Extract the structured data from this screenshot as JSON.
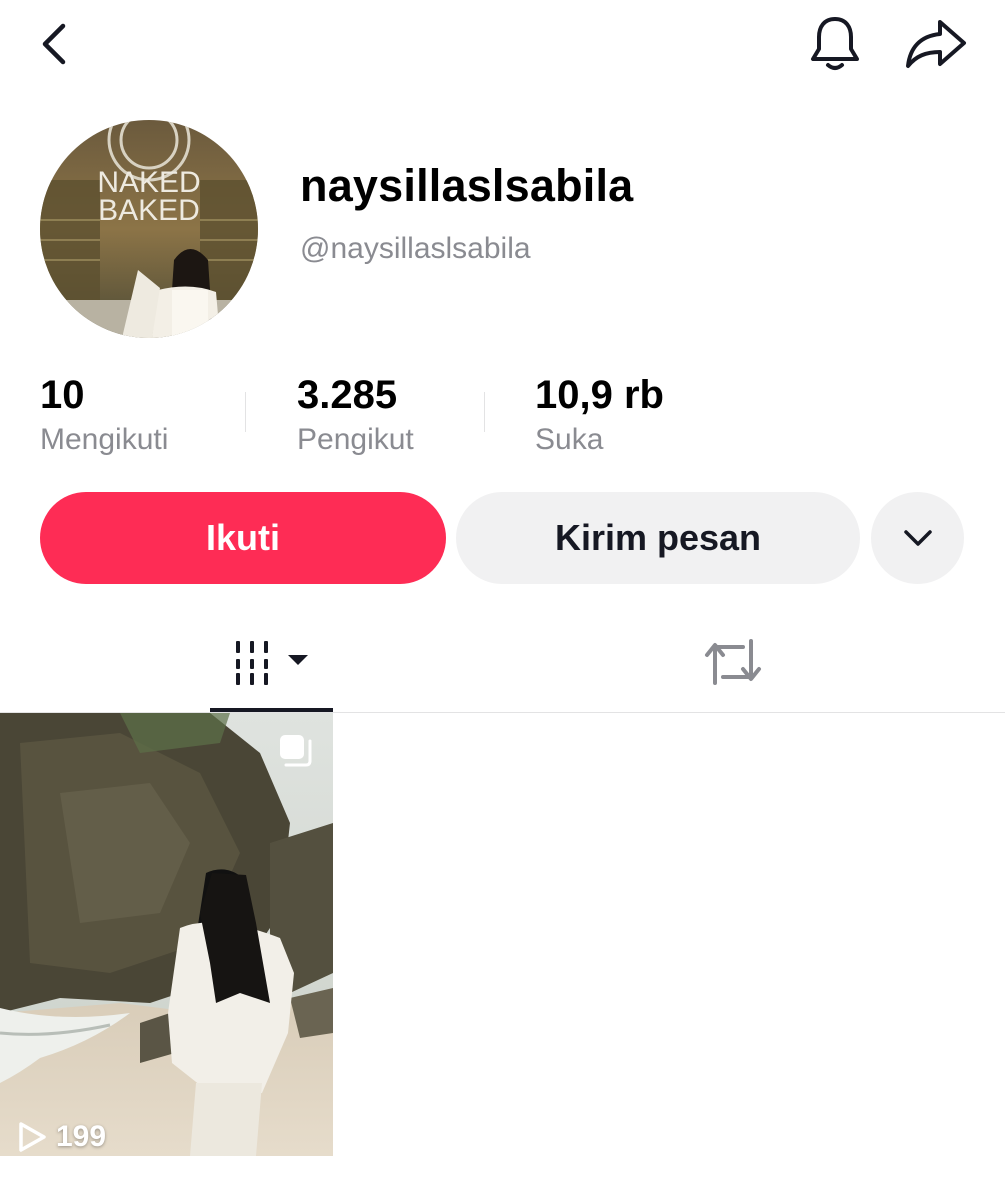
{
  "profile": {
    "username": "naysillaslsabila",
    "handle": "@naysillaslsabila",
    "avatar_sign_text": [
      "NAKED",
      "BAKED"
    ]
  },
  "stats": [
    {
      "value": "10",
      "label": "Mengikuti"
    },
    {
      "value": "3.285",
      "label": "Pengikut"
    },
    {
      "value": "10,9 rb",
      "label": "Suka"
    }
  ],
  "actions": {
    "follow_label": "Ikuti",
    "message_label": "Kirim pesan"
  },
  "icons": {
    "back": "chevron-left-icon",
    "notification": "bell-icon",
    "share": "share-arrow-icon",
    "more": "chevron-down-icon",
    "videos_tab": "video-grid-icon",
    "reposts_tab": "repost-icon",
    "play": "play-icon",
    "multi": "multi-content-icon"
  },
  "videos": [
    {
      "views": "199"
    }
  ],
  "colors": {
    "follow_button": "#fe2c55",
    "secondary_button": "#f1f1f2",
    "muted_text": "#8a8b91"
  }
}
